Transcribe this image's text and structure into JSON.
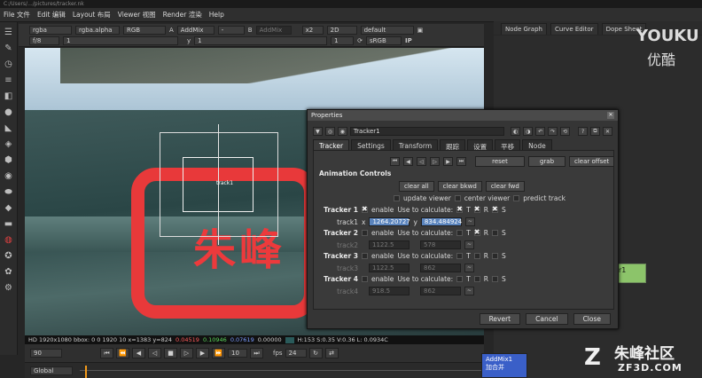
{
  "titlebar": {
    "text": "C:/Users/.../pictures/tracker.nk"
  },
  "menu": {
    "file": "File 文件",
    "edit": "Edit 编辑",
    "layout": "Layout 布局",
    "viewer": "Viewer 视图",
    "render": "Render 渲染",
    "help": "Help"
  },
  "viewer_toolbar": {
    "channels": "rgba",
    "alpha": "rgba.alpha",
    "rgb": "RGB",
    "a_label": "A",
    "a_merge": "AddMix",
    "a_input": "-",
    "b_label": "B",
    "b_merge": "AddMix",
    "zoom": "x2",
    "view_mode": "2D",
    "lut": "default",
    "fstop": "f/8",
    "gain": "1",
    "y_label": "y",
    "gamma": "1",
    "proxy": "1",
    "colorspace": "sRGB",
    "ip": "IP"
  },
  "viewer": {
    "track_label": "track1",
    "overlay_text": "朱峰"
  },
  "infobar": {
    "format": "HD 1920x1080 bbox: 0 0 1920 10 x=1383 y=824",
    "r": "0.04519",
    "g": "0.10946",
    "b": "0.07619",
    "a": "0.00000",
    "hsv": "H:153 S:0.35 V:0.36 L: 0.0934C"
  },
  "timeline": {
    "frame": "90",
    "step": "10",
    "fps_label": "fps",
    "fps": "24",
    "global": "Global"
  },
  "right_tabs": {
    "node_graph": "Node Graph",
    "curve_editor": "Curve Editor",
    "dope_sheet": "Dope Sheet"
  },
  "nodes": {
    "tracker": "r1",
    "admix": "AddMix1",
    "admix_sub": "加合并"
  },
  "watermark": {
    "youku": "YOUKU",
    "youku_cn": "优酷",
    "brand_cn": "朱峰社区",
    "brand_url": "ZF3D.COM"
  },
  "properties": {
    "title": "Properties",
    "node_name": "Tracker1",
    "tabs": [
      "Tracker",
      "Settings",
      "Transform",
      "跟踪",
      "设置",
      "平移",
      "Node"
    ],
    "transport_btns": [
      "reset",
      "grab",
      "clear offset"
    ],
    "anim_label": "Animation Controls",
    "clear_btns": [
      "clear all",
      "clear bkwd",
      "clear fwd"
    ],
    "options": [
      "update viewer",
      "center viewer",
      "predict track"
    ],
    "trackers": [
      {
        "name": "Tracker 1",
        "enable": "enable",
        "use": "Use to calculate:",
        "t": "T",
        "r": "R",
        "s": "S",
        "track_label": "track1",
        "x_label": "x",
        "x": "1264.20727",
        "y_label": "y",
        "y": "834.484924"
      },
      {
        "name": "Tracker 2",
        "enable": "enable",
        "use": "Use to calculate:",
        "t": "T",
        "r": "R",
        "s": "S",
        "track_label": "track2",
        "x": "1122.5",
        "y": "578"
      },
      {
        "name": "Tracker 3",
        "enable": "enable",
        "use": "Use to calculate:",
        "t": "T",
        "r": "R",
        "s": "S",
        "track_label": "track3",
        "x": "1122.5",
        "y": "862"
      },
      {
        "name": "Tracker 4",
        "enable": "enable",
        "use": "Use to calculate:",
        "t": "T",
        "r": "R",
        "s": "S",
        "track_label": "track4",
        "x": "918.5",
        "y": "862"
      }
    ],
    "footer": {
      "revert": "Revert",
      "cancel": "Cancel",
      "close": "Close"
    }
  }
}
